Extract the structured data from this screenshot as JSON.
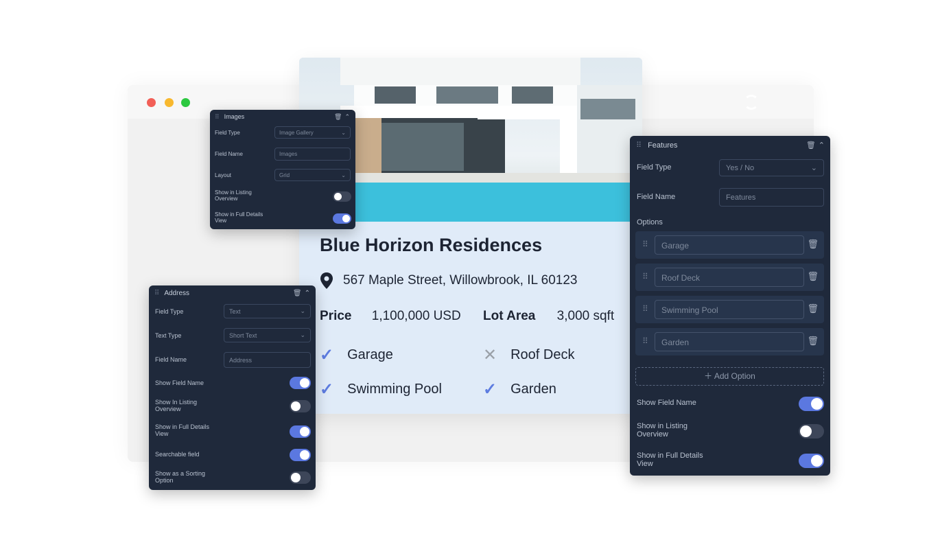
{
  "browser": {
    "dot_colors": [
      "#f25f57",
      "#f8b82e",
      "#2cc840"
    ],
    "refresh_icon": "refresh-icon"
  },
  "listing": {
    "title": "Blue Horizon Residences",
    "address": "567 Maple Street, Willowbrook, IL 60123",
    "price_label": "Price",
    "price": "1,100,000 USD",
    "lot_label": "Lot Area",
    "lot": "3,000 sqft",
    "features": [
      {
        "name": "Garage",
        "available": true
      },
      {
        "name": "Roof Deck",
        "available": false
      },
      {
        "name": "Swimming Pool",
        "available": true
      },
      {
        "name": "Garden",
        "available": true
      }
    ]
  },
  "images_panel": {
    "title": "Images",
    "field_type_label": "Field Type",
    "field_type": "Image Gallery",
    "field_name_label": "Field Name",
    "field_name": "Images",
    "layout_label": "Layout",
    "layout": "Grid",
    "listing_label": "Show in Listing Overview",
    "listing_on": false,
    "details_label": "Show in Full Details View",
    "details_on": true
  },
  "address_panel": {
    "title": "Address",
    "field_type_label": "Field Type",
    "field_type": "Text",
    "text_type_label": "Text Type",
    "text_type": "Short Text",
    "field_name_label": "Field Name",
    "field_name": "Address",
    "toggles": [
      {
        "label": "Show Field Name",
        "on": true
      },
      {
        "label": "Show In Listing Overview",
        "on": false
      },
      {
        "label": "Show in Full Details View",
        "on": true
      },
      {
        "label": "Searchable field",
        "on": true
      },
      {
        "label": "Show as a Sorting Option",
        "on": false
      }
    ]
  },
  "features_panel": {
    "title": "Features",
    "field_type_label": "Field Type",
    "field_type": "Yes / No",
    "field_name_label": "Field Name",
    "field_name": "Features",
    "options_label": "Options",
    "options": [
      "Garage",
      "Roof Deck",
      "Swimming Pool",
      "Garden"
    ],
    "add_option": "Add Option",
    "toggles": [
      {
        "label": "Show Field Name",
        "on": true
      },
      {
        "label": "Show in Listing Overview",
        "on": false
      },
      {
        "label": "Show in Full Details View",
        "on": true
      }
    ]
  },
  "colors": {
    "panel_bg": "#1f293b",
    "accent": "#5b78e0",
    "card_bg": "#e0ebf8"
  }
}
